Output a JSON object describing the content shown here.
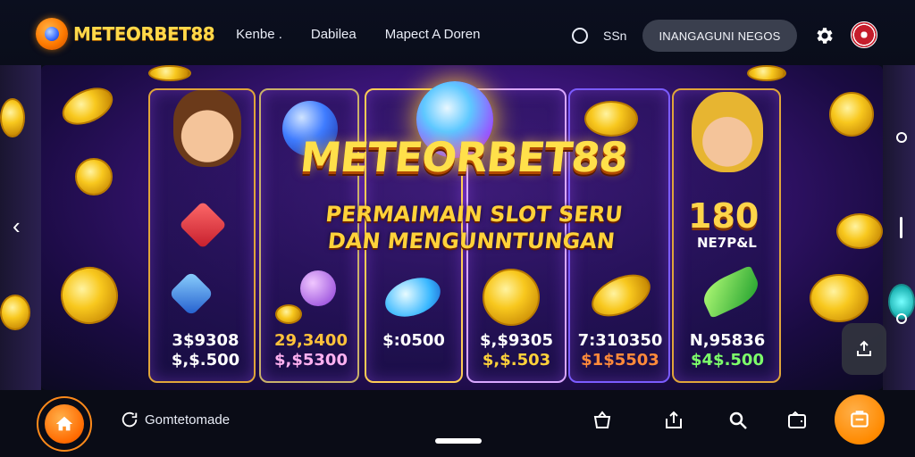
{
  "header": {
    "brand_name": "METEORBET88",
    "nav": [
      "Kenbe .",
      "Dabilea",
      "Mapect A Doren"
    ],
    "chat_label": "SSn",
    "search_label": "INANGAGUNI NEGOS",
    "icons": {
      "logo": "meteor-logo-icon",
      "chat": "chat-bubble-icon",
      "settings": "gear-icon",
      "avatar": "avatar-icon"
    }
  },
  "banner": {
    "title": "METEORBET88",
    "subtitle_line1": "PERMAIMAIN SLOT SERU",
    "subtitle_line2": "DAN MENGUNNTUNGAN",
    "badge_number": "180",
    "badge_label": "NE7P&L",
    "prizes": [
      {
        "top": "3$9308",
        "bottom": "$,$.500",
        "top_color": "#ffffff",
        "bottom_color": "#ffffff"
      },
      {
        "top": "29,3400",
        "bottom": "$,$5300",
        "top_color": "#ffc23a",
        "bottom_color": "#ffb1f0"
      },
      {
        "top": "",
        "bottom": "$:0500",
        "top_color": "#ffffff",
        "bottom_color": "#ffffff"
      },
      {
        "top": "$,$9305",
        "bottom": "$,$.503",
        "top_color": "#ffffff",
        "bottom_color": "#ffd23a"
      },
      {
        "top": "7:310350",
        "bottom": "$1$5503",
        "top_color": "#ffffff",
        "bottom_color": "#ff8a3a"
      },
      {
        "top": "N,95836",
        "bottom": "$4$.500",
        "top_color": "#ffffff",
        "bottom_color": "#7dff6a"
      }
    ]
  },
  "bottom_bar": {
    "label": "Gomtetomade",
    "icons": {
      "home": "home-icon",
      "label_icon": "refresh-icon",
      "basket": "basket-icon",
      "share": "share-icon",
      "search": "search-icon",
      "wallet": "wallet-icon",
      "fab": "transfer-icon",
      "float": "upload-icon"
    }
  },
  "colors": {
    "accent": "#ff8a1a",
    "brand_gold": "#ffd94a",
    "pill_bg": "#3a3f4e"
  }
}
